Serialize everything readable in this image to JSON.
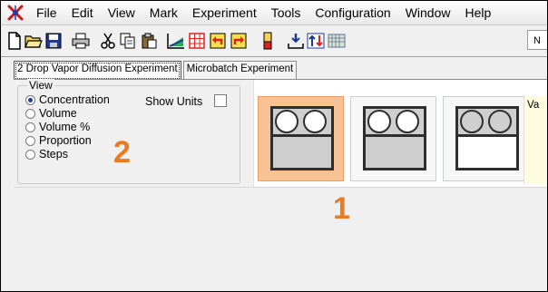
{
  "menu": [
    "File",
    "Edit",
    "View",
    "Mark",
    "Experiment",
    "Tools",
    "Configuration",
    "Window",
    "Help"
  ],
  "toolbar": {
    "icons": [
      "new-icon",
      "open-icon",
      "save-icon",
      "print-icon",
      "cut-icon",
      "copy-icon",
      "paste-icon",
      "chart-icon",
      "grid-icon",
      "undo-icon",
      "redo-icon",
      "column-icon",
      "dispense-icon",
      "sort-icon",
      "plate-icon"
    ],
    "right_field": "N"
  },
  "tabs": [
    "2 Drop Vapor Diffusion Experiment",
    "Microbatch Experiment"
  ],
  "view": {
    "legend": "View",
    "options": [
      "Concentration",
      "Volume",
      "Volume %",
      "Proportion",
      "Steps"
    ],
    "selected": "Concentration",
    "show_units_label": "Show Units",
    "show_units_checked": false
  },
  "wells": [
    {
      "selected": true,
      "drops": [
        "filled",
        "filled"
      ],
      "reservoir": "gray"
    },
    {
      "selected": false,
      "drops": [
        "filled",
        "filled"
      ],
      "reservoir": "gray"
    },
    {
      "selected": false,
      "drops": [
        "empty",
        "empty"
      ],
      "reservoir": "white"
    }
  ],
  "side_text": "Va",
  "annotations": [
    "1",
    "2"
  ],
  "colors": {
    "selected_well": "#f8c294",
    "annotation": "#ec7a22",
    "side_box": "#fffbe0"
  }
}
